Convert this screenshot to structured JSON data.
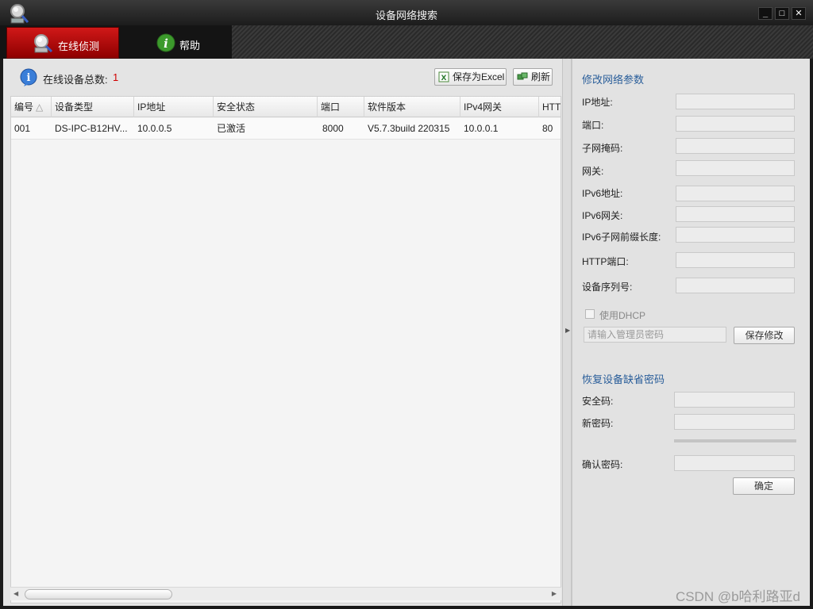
{
  "window": {
    "title": "设备网络搜索",
    "minimize": "_",
    "maximize": "□",
    "close": "✕"
  },
  "tabs": [
    {
      "label": "在线侦测",
      "icon": "magnifier-icon",
      "active": true
    },
    {
      "label": "帮助",
      "icon": "info-icon",
      "active": false
    }
  ],
  "toolbar": {
    "count_label": "在线设备总数:",
    "count_value": "1",
    "save_excel_label": "保存为Excel",
    "refresh_label": "刷新"
  },
  "table": {
    "columns": [
      "编号",
      "设备类型",
      "IP地址",
      "安全状态",
      "端口",
      "软件版本",
      "IPv4网关",
      "HTT"
    ],
    "rows": [
      [
        "001",
        "DS-IPC-B12HV...",
        "10.0.0.5",
        "已激活",
        "8000",
        "V5.7.3build 220315",
        "10.0.0.1",
        "80"
      ]
    ]
  },
  "network_params": {
    "title": "修改网络参数",
    "fields": [
      "IP地址:",
      "端口:",
      "子网掩码:",
      "网关:",
      "IPv6地址:",
      "IPv6网关:",
      "IPv6子网前缀长度:",
      "HTTP端口:",
      "设备序列号:"
    ],
    "dhcp_label": "使用DHCP",
    "admin_password_placeholder": "请输入管理员密码",
    "save_button": "保存修改"
  },
  "restore_password": {
    "title": "恢复设备缺省密码",
    "security_code_label": "安全码:",
    "new_password_label": "新密码:",
    "confirm_password_label": "确认密码:",
    "confirm_button": "确定"
  },
  "watermark": "CSDN @b哈利路亚d",
  "colors": {
    "active_tab": "#c00000",
    "section_title": "#2a5e9a",
    "count_value": "#d00000"
  }
}
